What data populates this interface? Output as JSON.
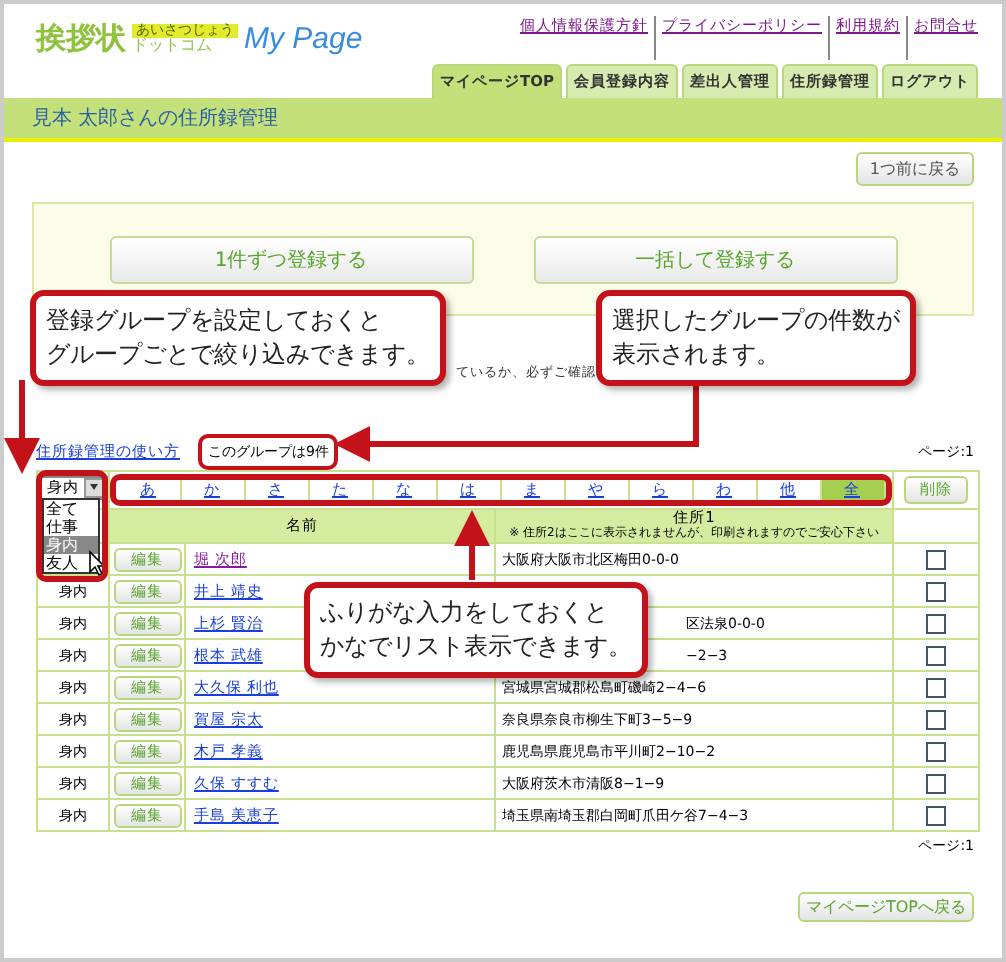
{
  "header": {
    "logo_main": "挨拶状",
    "logo_badge": "あいさつじょう",
    "logo_sub": "ドットコム",
    "logo_mypage": "My Page",
    "links": [
      "個人情報保護方針",
      "プライバシーポリシー",
      "利用規約",
      "お問合せ"
    ],
    "tabs": [
      {
        "label": "マイページTOP",
        "selected": true
      },
      {
        "label": "会員登録内容",
        "selected": false
      },
      {
        "label": "差出人管理",
        "selected": false
      },
      {
        "label": "住所録管理",
        "selected": false
      },
      {
        "label": "ログアウト",
        "selected": false
      }
    ]
  },
  "page_title": "見本 太郎さんの住所録管理",
  "back_button": "1つ前に戻る",
  "register_buttons": [
    "1件ずつ登録する",
    "一括して登録する"
  ],
  "notice_fragment": "ているか、必ずご確認",
  "help_link": "住所録管理の使い方",
  "group_count": "このグループは9件",
  "page_top": "ページ:1",
  "group_select": {
    "value": "身内",
    "options": [
      {
        "label": "全て",
        "selected": false
      },
      {
        "label": "仕事",
        "selected": false
      },
      {
        "label": "身内",
        "selected": true
      },
      {
        "label": "友人",
        "selected": false
      }
    ]
  },
  "kana_tabs": [
    {
      "label": "あ",
      "selected": false
    },
    {
      "label": "か",
      "selected": false
    },
    {
      "label": "さ",
      "selected": false
    },
    {
      "label": "た",
      "selected": false
    },
    {
      "label": "な",
      "selected": false
    },
    {
      "label": "は",
      "selected": false
    },
    {
      "label": "ま",
      "selected": false
    },
    {
      "label": "や",
      "selected": false
    },
    {
      "label": "ら",
      "selected": false
    },
    {
      "label": "わ",
      "selected": false
    },
    {
      "label": "他",
      "selected": false
    },
    {
      "label": "全",
      "selected": true
    }
  ],
  "delete_button": "削除",
  "columns": {
    "name": "名前",
    "address": "住所1",
    "address_note": "※ 住所2はここに表示されませんが、印刷されますのでご安心下さい"
  },
  "rows": [
    {
      "edit": "編集",
      "name": "堀 次郎",
      "address": "大阪府大阪市北区梅田0-0-0",
      "checked": false
    },
    {
      "group": "身内",
      "edit": "編集",
      "name": "井上 靖史",
      "checked": false
    },
    {
      "group": "身内",
      "edit": "編集",
      "name": "上杉 賢治",
      "address": "区法泉0-0-0",
      "kind": "partial",
      "checked": false
    },
    {
      "group": "身内",
      "edit": "編集",
      "name": "根本 武雄",
      "address": "−2−3",
      "kind": "partial",
      "checked": false
    },
    {
      "group": "身内",
      "edit": "編集",
      "name": "大久保 利也",
      "address": "宮城県宮城郡松島町磯崎2−4−6",
      "checked": false
    },
    {
      "group": "身内",
      "edit": "編集",
      "name": "賀屋 宗太",
      "address": "奈良県奈良市柳生下町3−5−9",
      "checked": false
    },
    {
      "group": "身内",
      "edit": "編集",
      "name": "木戸 孝義",
      "address": "鹿児島県鹿児島市平川町2−10−2",
      "checked": false
    },
    {
      "group": "身内",
      "edit": "編集",
      "name": "久保 すすむ",
      "address": "大阪府茨木市清阪8−1−9",
      "checked": false
    },
    {
      "group": "身内",
      "edit": "編集",
      "name": "手島 美恵子",
      "address": "埼玉県南埼玉郡白岡町爪田ケ谷7−4−3",
      "checked": false
    }
  ],
  "page_bottom": "ページ:1",
  "top_button": "マイページTOPへ戻る",
  "callouts": [
    [
      "登録グループを設定しておくと",
      "グループごとで絞り込みできます。"
    ],
    [
      "選択したグループの件数が",
      "表示されます。"
    ],
    [
      "ふりがな入力をしておくと",
      "かなでリスト表示できます。"
    ]
  ]
}
